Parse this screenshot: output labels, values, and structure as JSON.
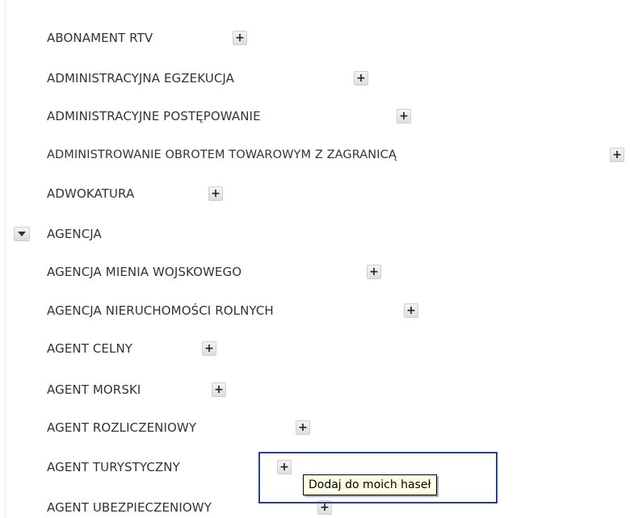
{
  "tree": {
    "items": [
      {
        "label": "ABONAMENT RTV",
        "add": "+"
      },
      {
        "label": "ADMINISTRACYJNA EGZEKUCJA",
        "add": "+"
      },
      {
        "label": "ADMINISTRACYJNE POSTĘPOWANIE",
        "add": "+"
      },
      {
        "label": "ADMINISTROWANIE OBROTEM TOWAROWYM Z ZAGRANICĄ",
        "add": "+"
      },
      {
        "label": "ADWOKATURA",
        "add": "+"
      },
      {
        "label": "AGENCJA",
        "expanded": true
      },
      {
        "label": "AGENCJA MIENIA WOJSKOWEGO",
        "add": "+"
      },
      {
        "label": "AGENCJA NIERUCHOMOŚCI ROLNYCH",
        "add": "+"
      },
      {
        "label": "AGENT CELNY",
        "add": "+"
      },
      {
        "label": "AGENT MORSKI",
        "add": "+"
      },
      {
        "label": "AGENT ROZLICZENIOWY",
        "add": "+"
      },
      {
        "label": "AGENT TURYSTYCZNY",
        "add": "+"
      },
      {
        "label": "AGENT UBEZPIECZENIOWY",
        "add": "+"
      }
    ]
  },
  "tooltip": {
    "text": "Dodaj do moich haseł"
  },
  "colors": {
    "highlight_border": "#2a3f8f",
    "tooltip_bg": "#ffffe1",
    "text": "#333333"
  }
}
